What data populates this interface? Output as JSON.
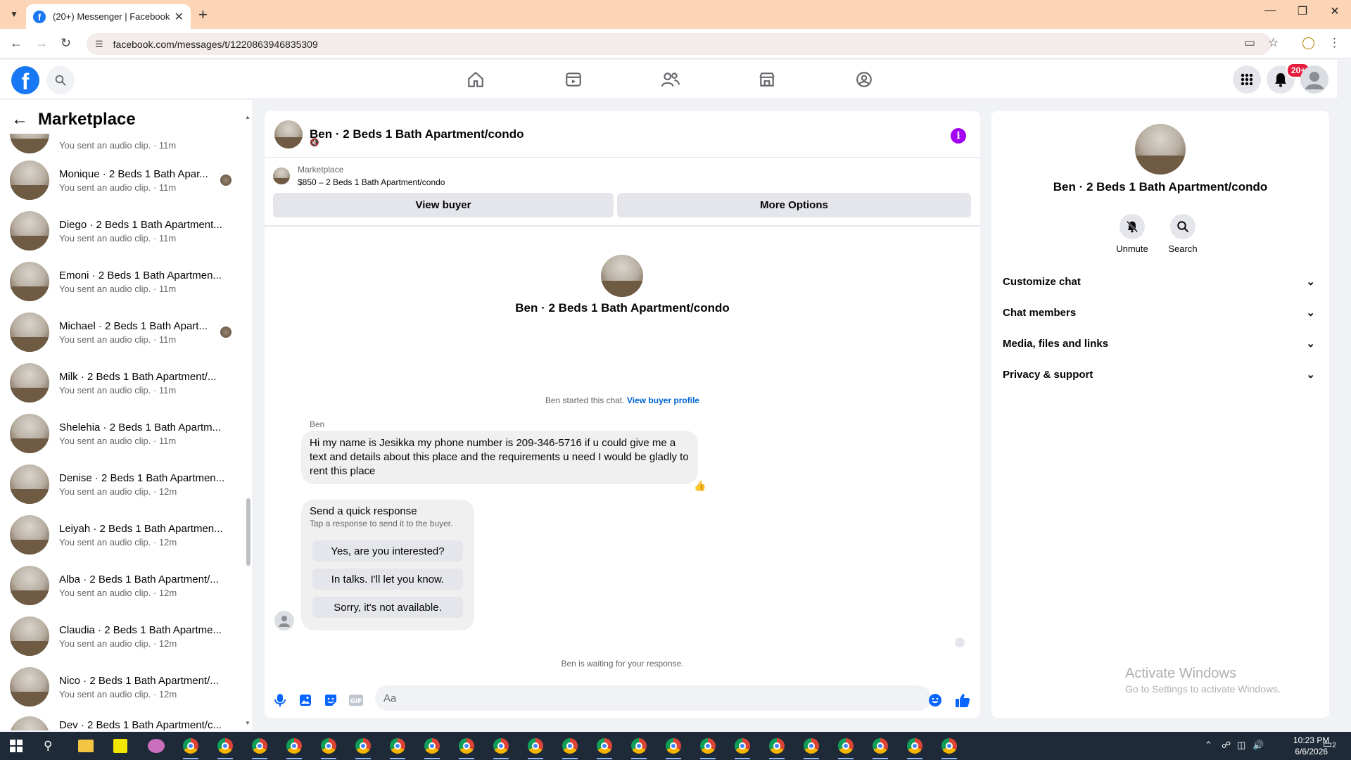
{
  "browser": {
    "tab_title": "(20+) Messenger | Facebook",
    "url": "facebook.com/messages/t/1220863946835309"
  },
  "header": {
    "notification_badge": "20+"
  },
  "sidebar": {
    "title": "Marketplace",
    "partial_top_sub": "You sent an audio clip. · 11m",
    "items": [
      {
        "name": "Monique · 2 Beds 1 Bath Apar...",
        "sub": "You sent an audio clip. · 11m",
        "seen": true
      },
      {
        "name": "Diego · 2 Beds 1 Bath Apartment...",
        "sub": "You sent an audio clip. · 11m",
        "seen": false
      },
      {
        "name": "Emoni · 2 Beds 1 Bath Apartmen...",
        "sub": "You sent an audio clip. · 11m",
        "seen": false
      },
      {
        "name": "Michael · 2 Beds 1 Bath Apart...",
        "sub": "You sent an audio clip. · 11m",
        "seen": true
      },
      {
        "name": "Milk · 2 Beds 1 Bath Apartment/...",
        "sub": "You sent an audio clip. · 11m",
        "seen": false
      },
      {
        "name": "Shelehia · 2 Beds 1 Bath Apartm...",
        "sub": "You sent an audio clip. · 11m",
        "seen": false
      },
      {
        "name": "Denise · 2 Beds 1 Bath Apartmen...",
        "sub": "You sent an audio clip. · 12m",
        "seen": false
      },
      {
        "name": "Leiyah · 2 Beds 1 Bath Apartmen...",
        "sub": "You sent an audio clip. · 12m",
        "seen": false
      },
      {
        "name": "Alba · 2 Beds 1 Bath Apartment/...",
        "sub": "You sent an audio clip. · 12m",
        "seen": false
      },
      {
        "name": "Claudia · 2 Beds 1 Bath Apartme...",
        "sub": "You sent an audio clip. · 12m",
        "seen": false
      },
      {
        "name": "Nico · 2 Beds 1 Bath Apartment/...",
        "sub": "You sent an audio clip. · 12m",
        "seen": false
      }
    ],
    "partial_bottom_name": "Dev · 2 Beds 1 Bath Apartment/c..."
  },
  "chat": {
    "title": "Ben · 2 Beds 1 Bath Apartment/condo",
    "listing_category": "Marketplace",
    "listing_price": "$850 – 2 Beds 1 Bath Apartment/condo",
    "view_buyer": "View buyer",
    "more_options": "More Options",
    "intro_name": "Ben · 2 Beds 1 Bath Apartment/condo",
    "started_text": "Ben started this chat.",
    "view_buyer_profile": "View buyer profile",
    "sender": "Ben",
    "message": "Hi my name is Jesikka my phone number is 209-346-5716 if u could give me a text and details about this place and the requirements u need I would be gladly to rent this place",
    "quick_title": "Send a quick response",
    "quick_sub": "Tap a response to send it to the buyer.",
    "quick_responses": [
      "Yes, are you interested?",
      "In talks. I'll let you know.",
      "Sorry, it's not available."
    ],
    "waiting": "Ben is waiting for your response.",
    "composer_placeholder": "Aa"
  },
  "right_panel": {
    "name": "Ben · 2 Beds 1 Bath Apartment/condo",
    "unmute": "Unmute",
    "search": "Search",
    "rows": [
      "Customize chat",
      "Chat members",
      "Media, files and links",
      "Privacy & support"
    ]
  },
  "watermark": {
    "line1": "Activate Windows",
    "line2": "Go to Settings to activate Windows."
  },
  "taskbar": {
    "time": "10:23 PM",
    "date": "6/6/2026",
    "notif_count": "2"
  },
  "colors": {
    "brand": "#1877f2",
    "info_purple": "#a100f2",
    "tab_strip": "#fbd5b5",
    "badge_red": "#e41e3f"
  }
}
